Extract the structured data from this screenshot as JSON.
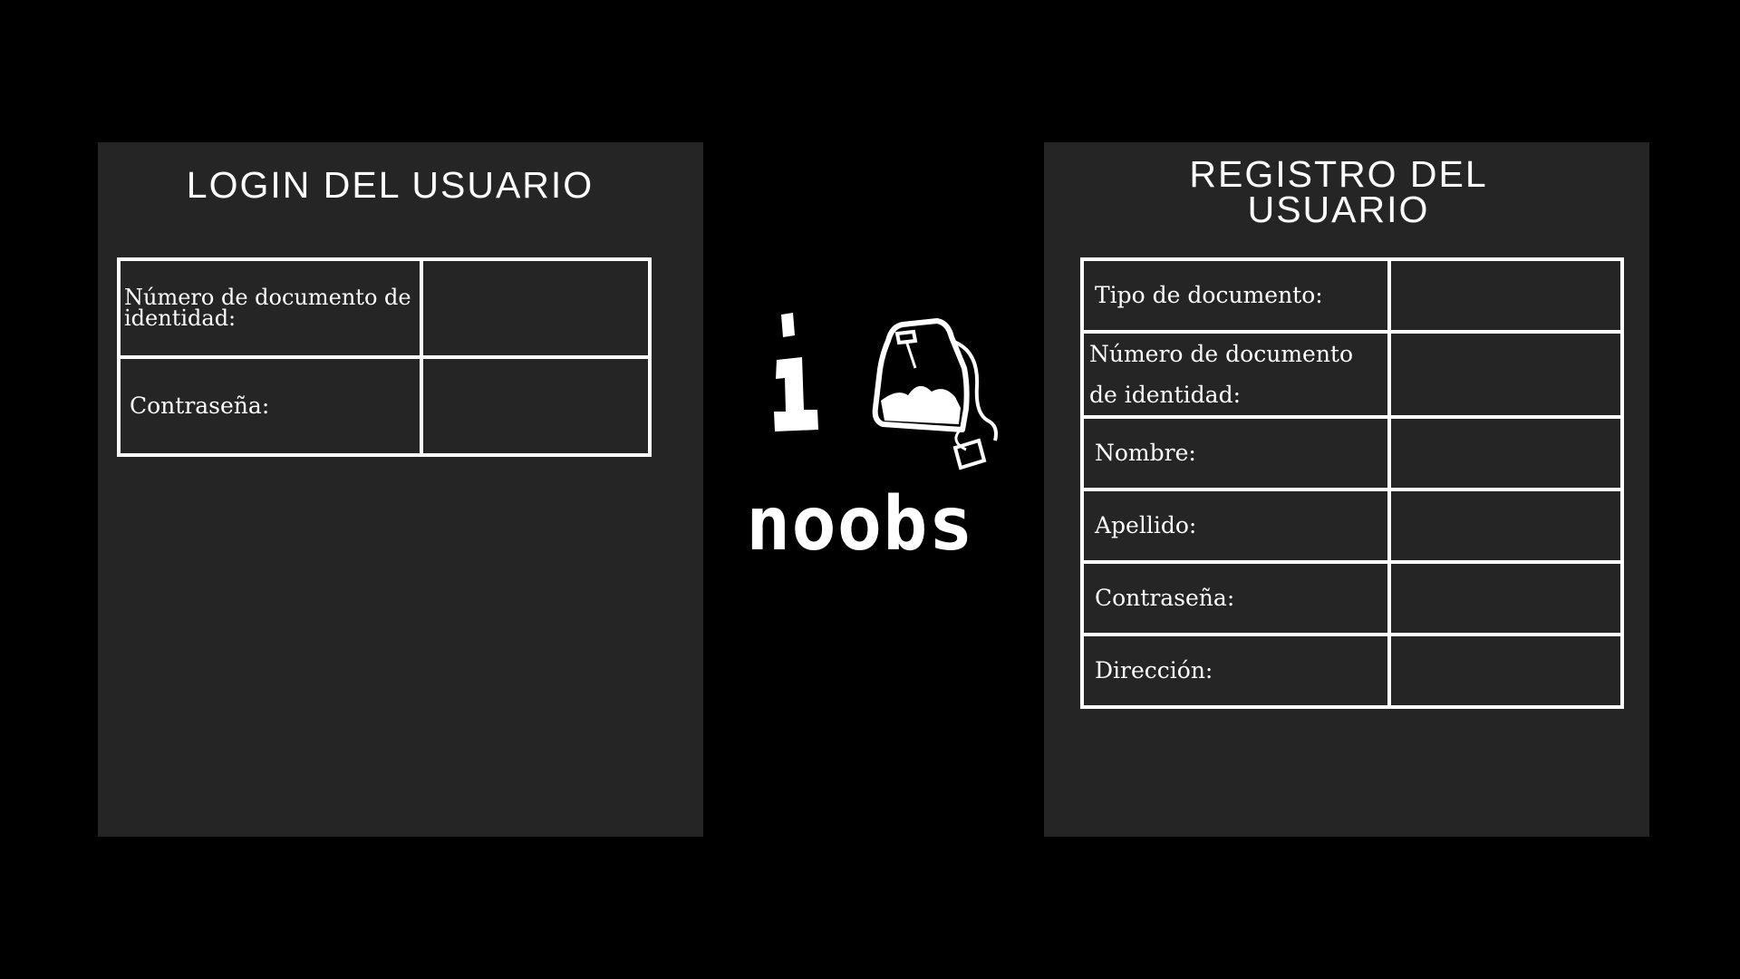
{
  "login": {
    "title": "LOGIN DEL USUARIO",
    "fields": [
      {
        "label": "Número de documento de identidad:",
        "value": ""
      },
      {
        "label": "Contraseña:",
        "value": ""
      }
    ]
  },
  "registro": {
    "title_line1": "REGISTRO DEL",
    "title_line2": "USUARIO",
    "fields": [
      {
        "label": "Tipo de documento:",
        "value": ""
      },
      {
        "label": "Número de documento de identidad:",
        "value": ""
      },
      {
        "label": "Nombre:",
        "value": ""
      },
      {
        "label": "Apellido:",
        "value": ""
      },
      {
        "label": "Contraseña:",
        "value": ""
      },
      {
        "label": "Dirección:",
        "value": ""
      }
    ]
  },
  "logo": {
    "text": "noobs",
    "icon": "teabag-icon"
  },
  "colors": {
    "background": "#000000",
    "panel": "#252525",
    "text": "#ffffff",
    "border": "#ffffff"
  }
}
